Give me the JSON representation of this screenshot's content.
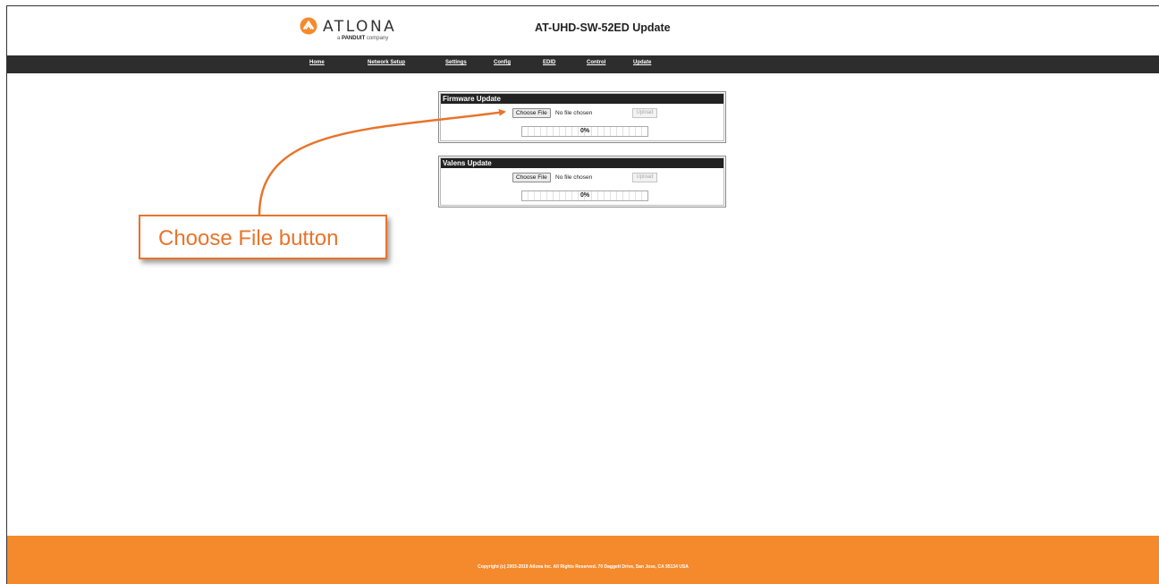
{
  "header": {
    "brand": "ATLONA",
    "brand_sub_prefix": "a",
    "brand_sub_company": "PANDUIT",
    "brand_sub_suffix": "company",
    "page_title": "AT-UHD-SW-52ED Update"
  },
  "nav": {
    "items": [
      {
        "label": "Home"
      },
      {
        "label": "Network Setup"
      },
      {
        "label": "Settings"
      },
      {
        "label": "Config"
      },
      {
        "label": "EDID"
      },
      {
        "label": "Control"
      },
      {
        "label": "Update"
      }
    ]
  },
  "firmware": {
    "title": "Firmware Update",
    "choose_label": "Choose File",
    "no_file_label": "No file chosen",
    "upload_label": "Upload",
    "progress_text": "0%",
    "progress": 0
  },
  "valens": {
    "title": "Valens Update",
    "choose_label": "Choose File",
    "no_file_label": "No file chosen",
    "upload_label": "Upload",
    "progress_text": "0%",
    "progress": 0
  },
  "callout": {
    "text": "Choose File button"
  },
  "footer": {
    "copyright": "Copyright (c) 2003-2019 Atlona Inc. All Rights Reserved. 70 Daggett Drive, San Jose, CA 95134 USA"
  },
  "colors": {
    "accent": "#f58a2c",
    "callout": "#e8742c",
    "nav_bg": "#2d2d2d"
  }
}
